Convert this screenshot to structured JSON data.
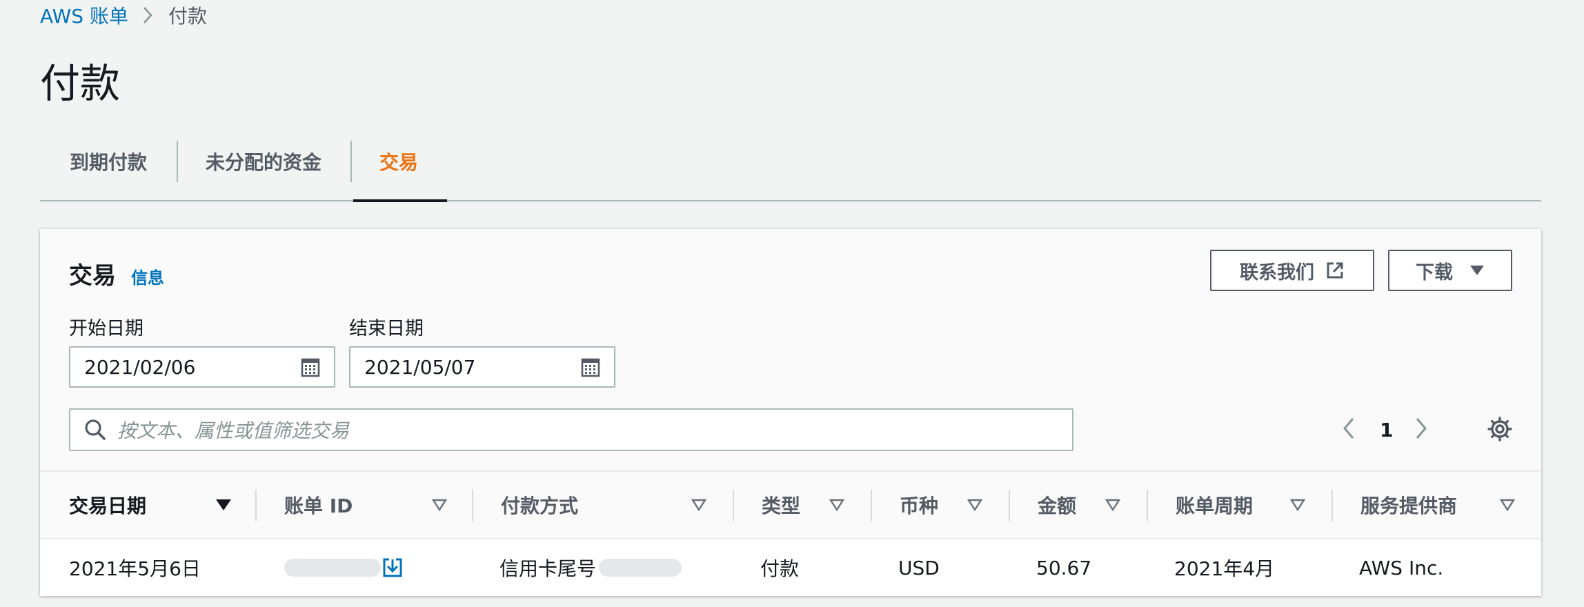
{
  "breadcrumb": {
    "root": "AWS 账单",
    "current": "付款"
  },
  "page": {
    "title": "付款"
  },
  "tabs": [
    {
      "label": "到期付款",
      "active": false
    },
    {
      "label": "未分配的资金",
      "active": false
    },
    {
      "label": "交易",
      "active": true
    }
  ],
  "panel": {
    "title": "交易",
    "info_link": "信息",
    "contact_button": "联系我们",
    "download_button": "下载",
    "start_date_label": "开始日期",
    "start_date_value": "2021/02/06",
    "end_date_label": "结束日期",
    "end_date_value": "2021/05/07",
    "search_placeholder": "按文本、属性或值筛选交易",
    "page_number": "1"
  },
  "table": {
    "columns": [
      "交易日期",
      "账单 ID",
      "付款方式",
      "类型",
      "币种",
      "金额",
      "账单周期",
      "服务提供商"
    ],
    "rows": [
      {
        "date": "2021年5月6日",
        "bill_id": "",
        "payment_method": "信用卡尾号",
        "type": "付款",
        "currency": "USD",
        "amount": "50.67",
        "period": "2021年4月",
        "provider": "AWS Inc."
      }
    ]
  },
  "colors": {
    "accent": "#ec7211",
    "link": "#0073bb",
    "text": "#16191f",
    "muted": "#545b64"
  }
}
